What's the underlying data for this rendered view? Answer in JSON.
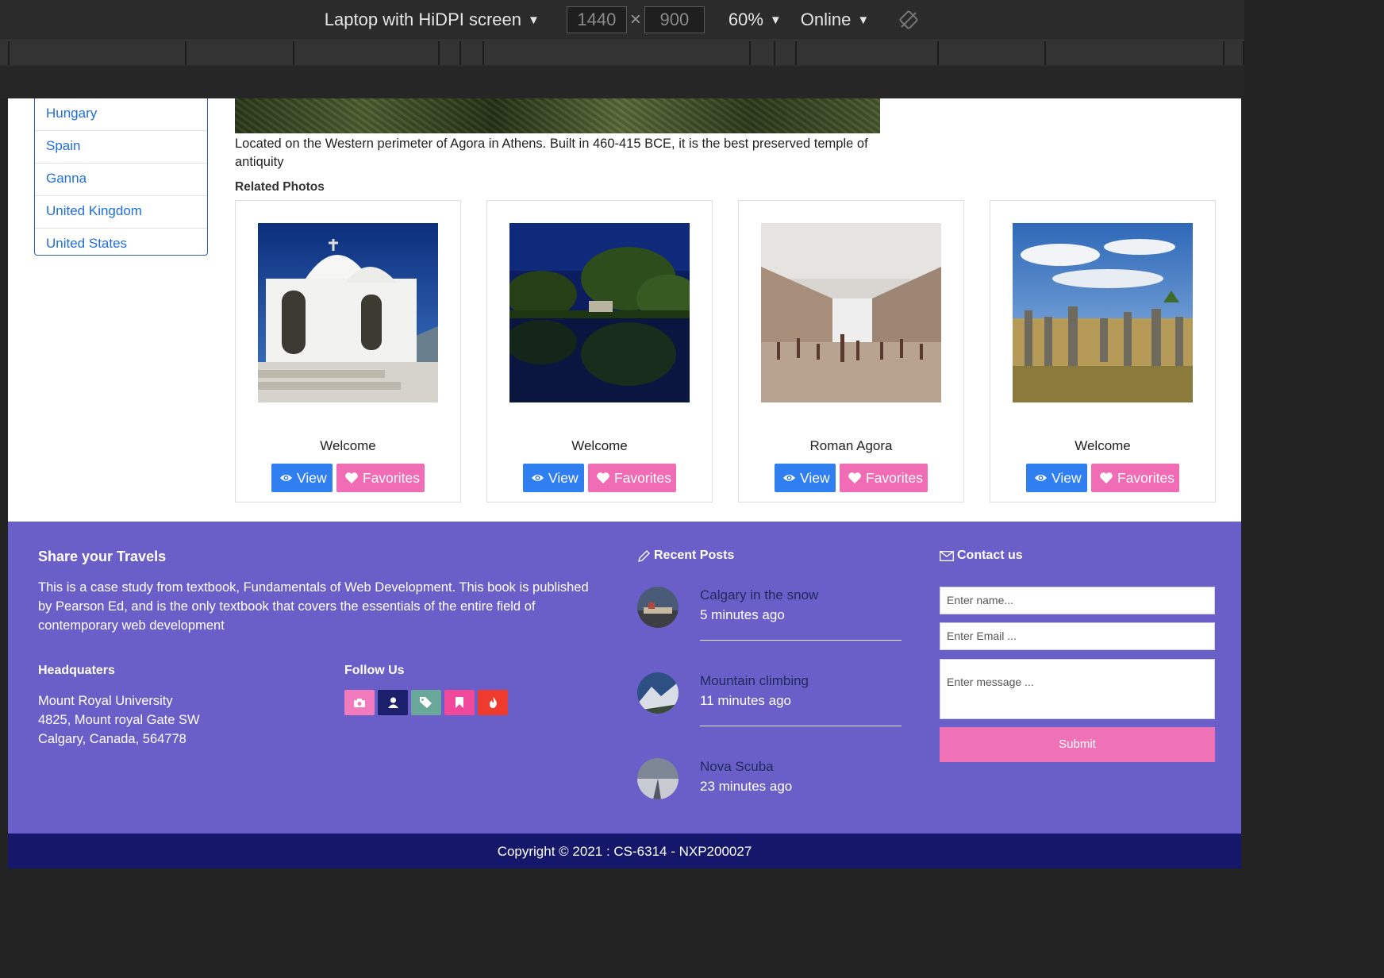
{
  "devtools": {
    "device": "Laptop with HiDPI screen",
    "width": "1440",
    "height": "900",
    "zoom": "60%",
    "network": "Online"
  },
  "countries": [
    "Hungary",
    "Spain",
    "Ganna",
    "United Kingdom",
    "United States"
  ],
  "photo": {
    "description": "Located on the Western perimeter of Agora in Athens. Built in 460-415 BCE, it is the best preserved temple of antiquity"
  },
  "related": {
    "title": "Related Photos",
    "view_label": "View",
    "favorites_label": "Favorites",
    "cards": [
      {
        "caption": "Welcome"
      },
      {
        "caption": "Welcome"
      },
      {
        "caption": "Roman Agora"
      },
      {
        "caption": "Welcome"
      }
    ]
  },
  "footer": {
    "share_title": "Share your Travels",
    "share_text": "This is a case study from textbook, Fundamentals of Web Development. This book is published by Pearson Ed, and is the only textbook that covers the essentials of the entire field of contemporary web development",
    "hq_title": "Headquaters",
    "hq_lines": [
      "Mount Royal University",
      "4825, Mount royal Gate SW",
      "Calgary, Canada, 564778"
    ],
    "follow_title": "Follow Us",
    "social_icons": [
      "camera-icon",
      "user-icon",
      "tags-icon",
      "bookmark-icon",
      "fire-icon"
    ],
    "social_colors": [
      "#f27bbd",
      "#1c1f6b",
      "#6aa79b",
      "#f0499b",
      "#ef3b2e"
    ],
    "recent_title": "Recent Posts",
    "posts": [
      {
        "title": "Calgary in the snow",
        "time": "5 minutes ago"
      },
      {
        "title": "Mountain climbing",
        "time": "11 minutes ago"
      },
      {
        "title": "Nova Scuba",
        "time": "23 minutes ago"
      }
    ],
    "contact_title": "Contact us",
    "name_placeholder": "Enter name...",
    "email_placeholder": "Enter Email ...",
    "message_placeholder": "Enter message ...",
    "submit_label": "Submit",
    "copyright": "Copyright © 2021 : CS-6314 - NXP200027"
  }
}
